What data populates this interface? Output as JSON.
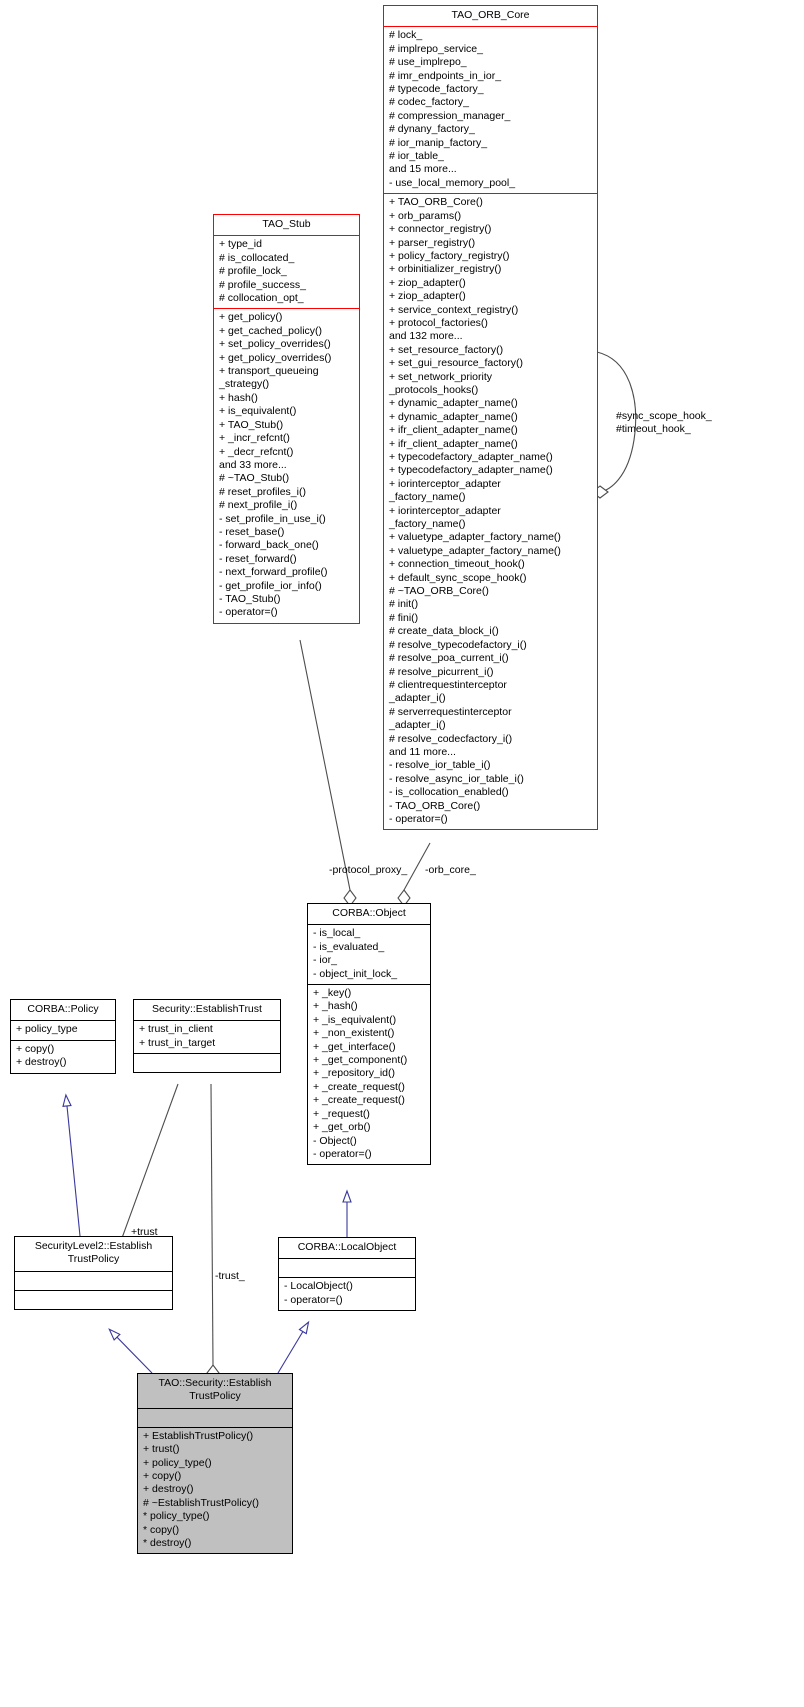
{
  "diagram": {
    "kind": "uml-class-diagram",
    "title": "TAO::Security::EstablishTrustPolicy collaboration diagram",
    "colors": {
      "node_border": "#000000",
      "highlight_border": "#ff0000",
      "selected_fill": "#c0c0c0",
      "inheritance_edge": "#38379c",
      "association_edge": "#4d4d4d",
      "background": "#ffffff"
    }
  },
  "nodes": {
    "tao_orb_core": {
      "name": "TAO_ORB_Core",
      "attributes": [
        "# lock_",
        "# implrepo_service_",
        "# use_implrepo_",
        "# imr_endpoints_in_ior_",
        "# typecode_factory_",
        "# codec_factory_",
        "# compression_manager_",
        "# dynany_factory_",
        "# ior_manip_factory_",
        "# ior_table_",
        "and 15 more...",
        "- use_local_memory_pool_"
      ],
      "operations": [
        "+ TAO_ORB_Core()",
        "+ orb_params()",
        "+ connector_registry()",
        "+ parser_registry()",
        "+ policy_factory_registry()",
        "+ orbinitializer_registry()",
        "+ ziop_adapter()",
        "+ ziop_adapter()",
        "+ service_context_registry()",
        "+ protocol_factories()",
        "and 132 more...",
        "+ set_resource_factory()",
        "+ set_gui_resource_factory()",
        "+ set_network_priority\n_protocols_hooks()",
        "+ dynamic_adapter_name()",
        "+ dynamic_adapter_name()",
        "+ ifr_client_adapter_name()",
        "+ ifr_client_adapter_name()",
        "+ typecodefactory_adapter_name()",
        "+ typecodefactory_adapter_name()",
        "+ iorinterceptor_adapter\n_factory_name()",
        "+ iorinterceptor_adapter\n_factory_name()",
        "+ valuetype_adapter_factory_name()",
        "+ valuetype_adapter_factory_name()",
        "+ connection_timeout_hook()",
        "+ default_sync_scope_hook()",
        "# ~TAO_ORB_Core()",
        "# init()",
        "# fini()",
        "# create_data_block_i()",
        "# resolve_typecodefactory_i()",
        "# resolve_poa_current_i()",
        "# resolve_picurrent_i()",
        "# clientrequestinterceptor\n_adapter_i()",
        "# serverrequestinterceptor\n_adapter_i()",
        "# resolve_codecfactory_i()",
        "and 11 more...",
        "- resolve_ior_table_i()",
        "- resolve_async_ior_table_i()",
        "- is_collocation_enabled()",
        "- TAO_ORB_Core()",
        "- operator=()"
      ]
    },
    "tao_stub": {
      "name": "TAO_Stub",
      "attributes": [
        "+ type_id",
        "# is_collocated_",
        "# profile_lock_",
        "# profile_success_",
        "# collocation_opt_"
      ],
      "operations": [
        "+ get_policy()",
        "+ get_cached_policy()",
        "+ set_policy_overrides()",
        "+ get_policy_overrides()",
        "+ transport_queueing\n_strategy()",
        "+ hash()",
        "+ is_equivalent()",
        "+ TAO_Stub()",
        "+ _incr_refcnt()",
        "+ _decr_refcnt()",
        "and 33 more...",
        "# ~TAO_Stub()",
        "# reset_profiles_i()",
        "# next_profile_i()",
        "- set_profile_in_use_i()",
        "- reset_base()",
        "- forward_back_one()",
        "- reset_forward()",
        "- next_forward_profile()",
        "- get_profile_ior_info()",
        "- TAO_Stub()",
        "- operator=()"
      ]
    },
    "corba_object": {
      "name": "CORBA::Object",
      "attributes": [
        "- is_local_",
        "- is_evaluated_",
        "- ior_",
        "- object_init_lock_"
      ],
      "operations": [
        "+ _key()",
        "+ _hash()",
        "+ _is_equivalent()",
        "+ _non_existent()",
        "+ _get_interface()",
        "+ _get_component()",
        "+ _repository_id()",
        "+ _create_request()",
        "+ _create_request()",
        "+ _request()",
        "+ _get_orb()",
        "- Object()",
        "- operator=()"
      ]
    },
    "corba_policy": {
      "name": "CORBA::Policy",
      "attributes": [
        "+ policy_type"
      ],
      "operations": [
        "+ copy()",
        "+ destroy()"
      ]
    },
    "security_establish_trust": {
      "name": "Security::EstablishTrust",
      "attributes": [
        "+ trust_in_client",
        "+ trust_in_target"
      ],
      "operations": []
    },
    "security_level2_establish_trust_policy": {
      "name": "SecurityLevel2::Establish\nTrustPolicy",
      "attributes": [],
      "operations": []
    },
    "corba_localobject": {
      "name": "CORBA::LocalObject",
      "attributes": [],
      "operations": [
        "- LocalObject()",
        "- operator=()"
      ]
    },
    "tao_security_establish_trust_policy": {
      "name": "TAO::Security::Establish\nTrustPolicy",
      "attributes": [],
      "operations": [
        "+ EstablishTrustPolicy()",
        "+ trust()",
        "+ policy_type()",
        "+ copy()",
        "+ destroy()",
        "# ~EstablishTrustPolicy()",
        "* policy_type()",
        "* copy()",
        "* destroy()"
      ]
    }
  },
  "edge_labels": {
    "sync_scope_timeout_hook": "#sync_scope_hook_\n#timeout_hook_",
    "protocol_proxy": "-protocol_proxy_",
    "orb_core": "-orb_core_",
    "trust_plus": "+trust",
    "trust_underscore": "-trust_"
  }
}
